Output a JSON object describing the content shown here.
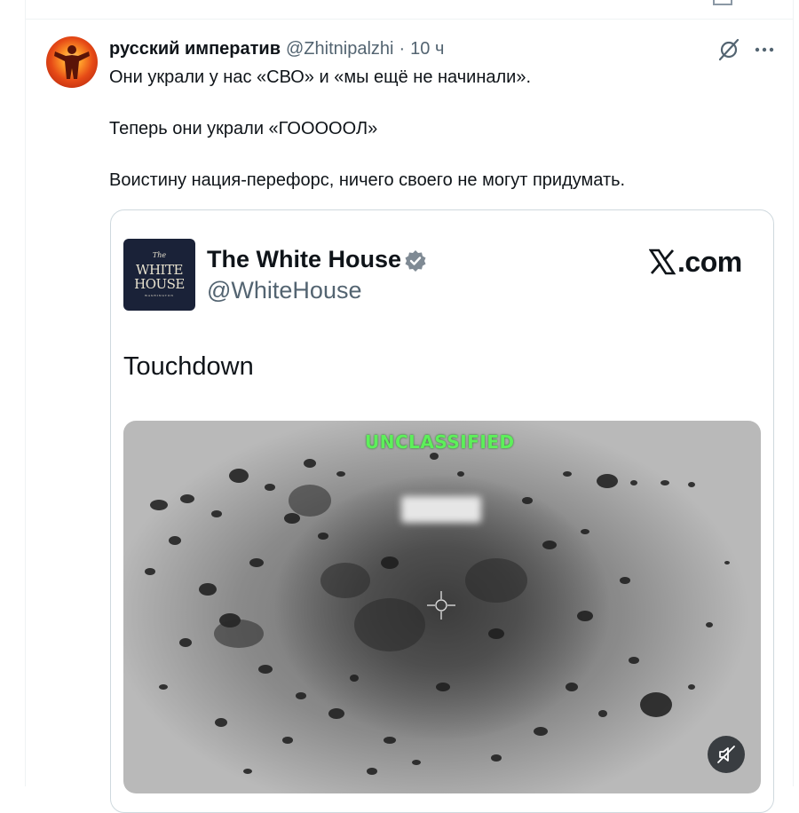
{
  "tweet": {
    "author_name": "русский императив",
    "author_handle": "@Zhitnipalzhi",
    "separator": "·",
    "time": "10 ч",
    "lines": [
      "Они украли у нас «СВО» и «мы ещё не начинали».",
      "Теперь они украли «ГОООООЛ»",
      "Воистину нация-перефорс, ничего своего не могут придумать."
    ]
  },
  "quoted": {
    "name": "The White House",
    "handle": "@WhiteHouse",
    "site": ".com",
    "text": "Touchdown",
    "logo": {
      "line1": "The",
      "line2": "WHITE",
      "line3": "HOUSE",
      "line4": "WASHINGTON"
    },
    "media_overlay_text": "UNCLASSIFIED"
  },
  "icons": {
    "grok": "grok-icon",
    "more": "more-icon",
    "verified": "verified-badge-icon",
    "x_logo": "x-logo-icon",
    "mute": "muted-speaker-icon"
  },
  "colors": {
    "text": "#0f1419",
    "secondary": "#536471",
    "border": "#cfd9de",
    "overlay_green": "#5df05a",
    "logo_bg": "#1a2238"
  }
}
